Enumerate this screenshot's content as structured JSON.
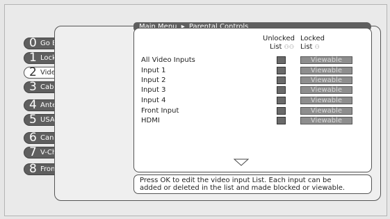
{
  "menu": {
    "items": [
      {
        "num": "0",
        "label": "Go Back",
        "selected": false
      },
      {
        "num": "1",
        "label": "Lock TV",
        "selected": false
      },
      {
        "num": "2",
        "label": "Video Input List",
        "selected": true
      },
      {
        "num": "3",
        "label": "Cable Channel List",
        "selected": false
      },
      {
        "num": "4",
        "label": "Antenna Ch. List",
        "selected": false
      },
      {
        "num": "5",
        "label": "USA V-Chip",
        "selected": false
      },
      {
        "num": "6",
        "label": "Canada V-Chip",
        "selected": false
      },
      {
        "num": "7",
        "label": "V-Chip Unrated",
        "selected": false
      },
      {
        "num": "8",
        "label": "Front Button Block",
        "selected": false
      }
    ]
  },
  "breadcrumb": {
    "root": "Main Menu",
    "separator": "▸",
    "current": "Parental Controls"
  },
  "columns": {
    "unlocked_line1": "Unlocked",
    "unlocked_line2": "List",
    "locked_line1": "Locked",
    "locked_line2": "List"
  },
  "inputs": [
    {
      "label": "All Video Inputs",
      "status": "Viewable"
    },
    {
      "label": "Input 1",
      "status": "Viewable"
    },
    {
      "label": "Input 2",
      "status": "Viewable"
    },
    {
      "label": "Input 3",
      "status": "Viewable"
    },
    {
      "label": "Input 4",
      "status": "Viewable"
    },
    {
      "label": "Front Input",
      "status": "Viewable"
    },
    {
      "label": "HDMI",
      "status": "Viewable"
    }
  ],
  "help": {
    "line1": "Press OK to edit the video input List. Each input can be",
    "line2": "added or deleted in the list and made blocked or viewable."
  },
  "colors": {
    "menu_button": "#5f5f5f",
    "selected_button": "#ffffff",
    "checkbox": "#6a6a6a",
    "viewable_button": "#8e8e8e"
  }
}
